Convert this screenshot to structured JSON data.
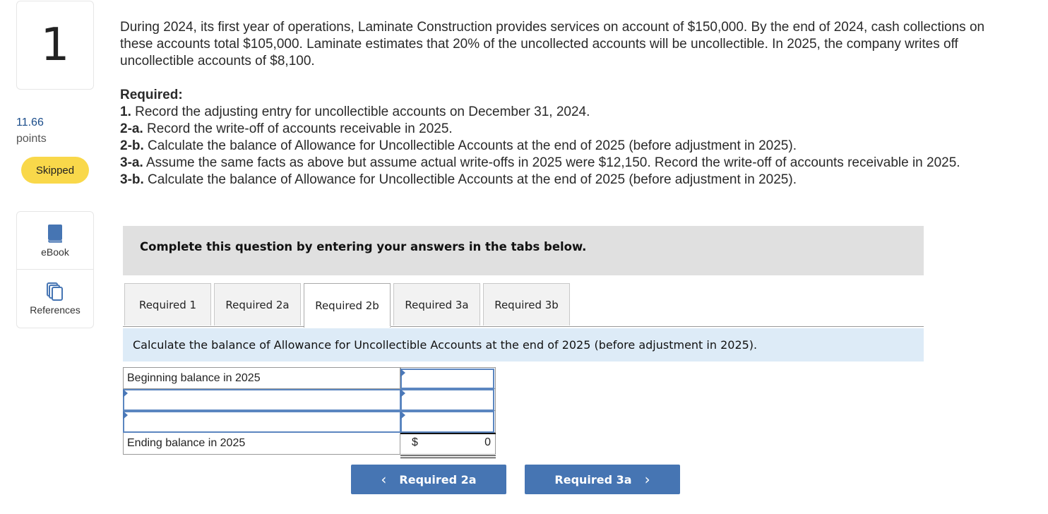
{
  "sidebar": {
    "question_number": "1",
    "points_value": "11.66",
    "points_label": "points",
    "status_badge": "Skipped",
    "tools": [
      {
        "label": "eBook",
        "icon": "book-icon"
      },
      {
        "label": "References",
        "icon": "copies-icon"
      }
    ]
  },
  "question": {
    "text": "During 2024, its first year of operations, Laminate Construction provides services on account of $150,000. By the end of 2024, cash collections on these accounts total $105,000. Laminate estimates that 20% of the uncollected accounts will be uncollectible. In 2025, the company writes off uncollectible accounts of $8,100.",
    "required_heading": "Required:",
    "required_items": [
      {
        "num": "1.",
        "text": " Record the adjusting entry for uncollectible accounts on December 31, 2024."
      },
      {
        "num": "2-a.",
        "text": " Record the write-off of accounts receivable in 2025."
      },
      {
        "num": "2-b.",
        "text": " Calculate the balance of Allowance for Uncollectible Accounts at the end of 2025 (before adjustment in 2025)."
      },
      {
        "num": "3-a.",
        "text": " Assume the same facts as above but assume actual write-offs in 2025 were $12,150. Record the write-off of accounts receivable in 2025."
      },
      {
        "num": "3-b.",
        "text": " Calculate the balance of Allowance for Uncollectible Accounts at the end of 2025 (before adjustment in 2025)."
      }
    ]
  },
  "instructions": "Complete this question by entering your answers in the tabs below.",
  "tabs": [
    {
      "label": "Required 1",
      "active": false
    },
    {
      "label": "Required 2a",
      "active": false
    },
    {
      "label": "Required 2b",
      "active": true
    },
    {
      "label": "Required 3a",
      "active": false
    },
    {
      "label": "Required 3b",
      "active": false
    }
  ],
  "tab_prompt": "Calculate the balance of Allowance for Uncollectible Accounts at the end of 2025 (before adjustment in 2025).",
  "table": {
    "rows": [
      {
        "label": "Beginning balance in 2025",
        "label_editable": false,
        "label_value": "",
        "amount_value": ""
      },
      {
        "label": "",
        "label_editable": true,
        "label_value": "",
        "amount_value": ""
      },
      {
        "label": "",
        "label_editable": true,
        "label_value": "",
        "amount_value": ""
      }
    ],
    "total": {
      "label": "Ending balance in 2025",
      "currency": "$",
      "value": "0"
    }
  },
  "nav": {
    "prev_label": "Required 2a",
    "next_label": "Required 3a",
    "prev_icon": "‹",
    "next_icon": "›",
    "button_color": "#4675b3"
  }
}
